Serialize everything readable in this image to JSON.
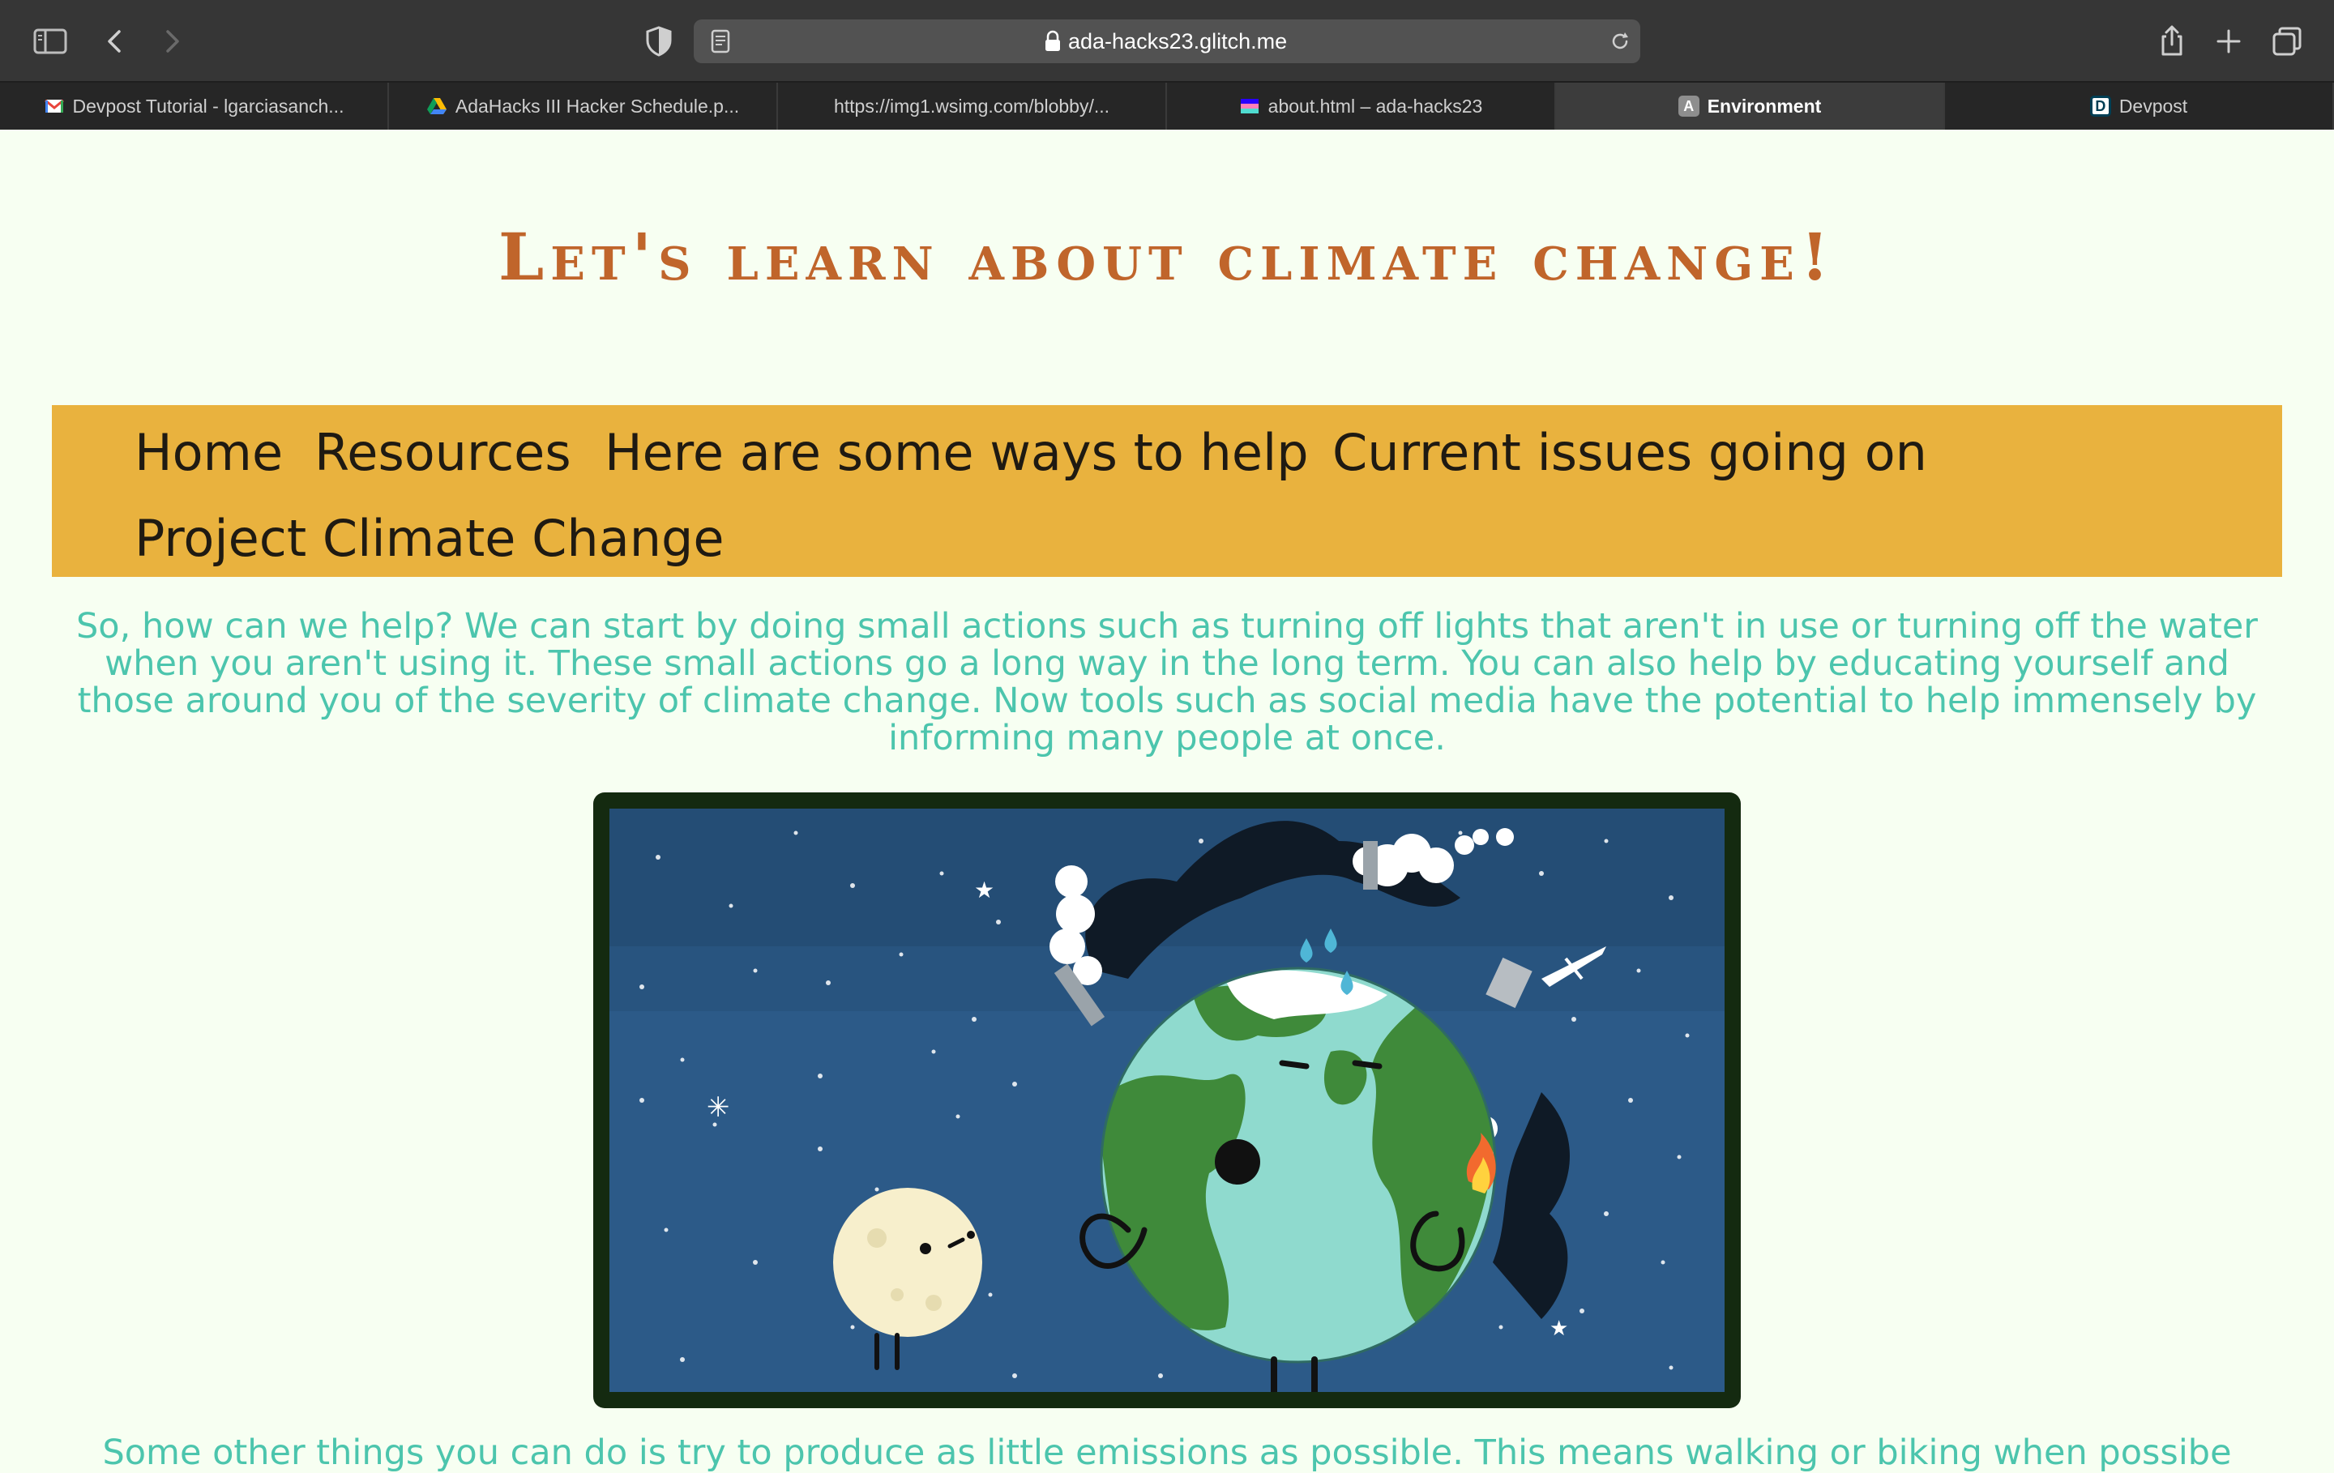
{
  "browser": {
    "url": "ada-hacks23.glitch.me",
    "tabs": [
      {
        "label": "Devpost Tutorial - lgarciasanch...",
        "favicon": "gmail-icon",
        "active": false
      },
      {
        "label": "AdaHacks III Hacker Schedule.p...",
        "favicon": "google-drive-icon",
        "active": false
      },
      {
        "label": "https://img1.wsimg.com/blobby/...",
        "favicon": "",
        "active": false
      },
      {
        "label": "about.html – ada-hacks23",
        "favicon": "glitch-icon",
        "active": false
      },
      {
        "label": "Environment",
        "favicon": "letter-a-icon",
        "favicon_text": "A",
        "active": true
      },
      {
        "label": "Devpost",
        "favicon": "devpost-icon",
        "favicon_text": "D",
        "active": false
      }
    ]
  },
  "page": {
    "title": "Let's learn about climate change!",
    "nav": {
      "home": "Home",
      "resources": "Resources",
      "help": "Here are some ways to help",
      "issues": "Current issues going on",
      "project": "Project Climate Change"
    },
    "paragraph1": "So, how can we help? We can start by doing small actions such as turning off lights that aren't in use or turning off the water when you aren't using it. These small actions go a long way in the long term. You can also help by educating yourself and those around you of the severity of climate change. Now tools such as social media have the potential to help immensely by informing many people at once.",
    "image_alt": "Illustration of a sad, polluted Earth next to the Moon in space",
    "paragraph2": "Some other things you can do is try to produce as little emissions as possible. This means walking or biking when possibe"
  },
  "colors": {
    "background": "#f7fff2",
    "title": "#c0652b",
    "nav_bg": "#e9b23e",
    "paragraph": "#4cc5ad",
    "frame": "#142a10"
  }
}
